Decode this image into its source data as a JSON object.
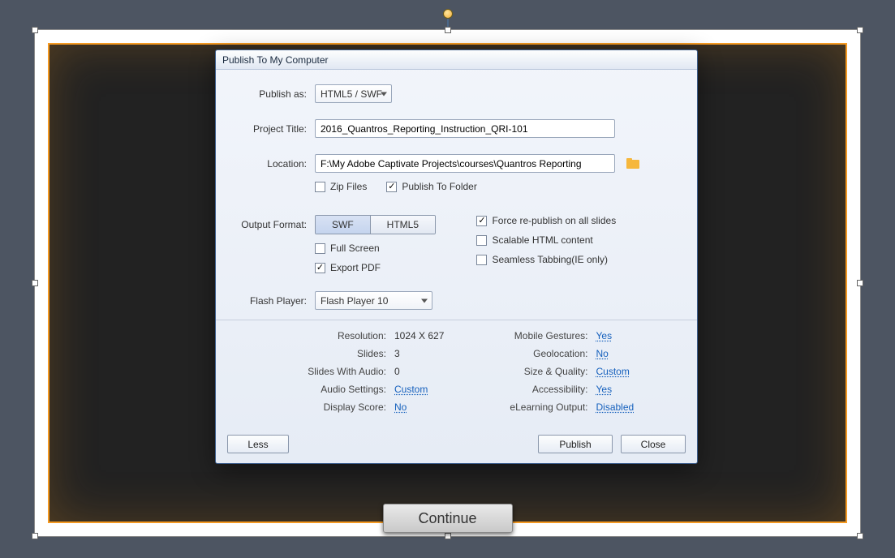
{
  "dialog": {
    "title": "Publish To My Computer",
    "labels": {
      "publish_as": "Publish as:",
      "project_title": "Project Title:",
      "location": "Location:",
      "output_format": "Output Format:",
      "flash_player": "Flash Player:"
    },
    "publish_as_value": "HTML5 / SWF",
    "project_title_value": "2016_Quantros_Reporting_Instruction_QRI-101",
    "location_value": "F:\\My Adobe Captivate Projects\\courses\\Quantros Reporting",
    "zip_files_label": "Zip Files",
    "publish_to_folder_label": "Publish To Folder",
    "swf_label": "SWF",
    "html5_label": "HTML5",
    "full_screen_label": "Full Screen",
    "export_pdf_label": "Export PDF",
    "force_republish_label": "Force re-publish on all slides",
    "scalable_label": "Scalable HTML content",
    "seamless_label": "Seamless Tabbing(IE only)",
    "flash_player_value": "Flash Player 10",
    "info": {
      "resolution_label": "Resolution:",
      "resolution_value": "1024 X 627",
      "slides_label": "Slides:",
      "slides_value": "3",
      "slides_audio_label": "Slides With Audio:",
      "slides_audio_value": "0",
      "audio_settings_label": "Audio Settings:",
      "audio_settings_value": "Custom",
      "display_score_label": "Display Score:",
      "display_score_value": "No",
      "mobile_label": "Mobile Gestures:",
      "mobile_value": "Yes",
      "geo_label": "Geolocation:",
      "geo_value": "No",
      "size_label": "Size & Quality:",
      "size_value": "Custom",
      "access_label": "Accessibility:",
      "access_value": "Yes",
      "elearn_label": "eLearning Output:",
      "elearn_value": "Disabled"
    },
    "buttons": {
      "less": "Less",
      "publish": "Publish",
      "close": "Close"
    }
  },
  "canvas": {
    "continue_label": "Continue"
  }
}
